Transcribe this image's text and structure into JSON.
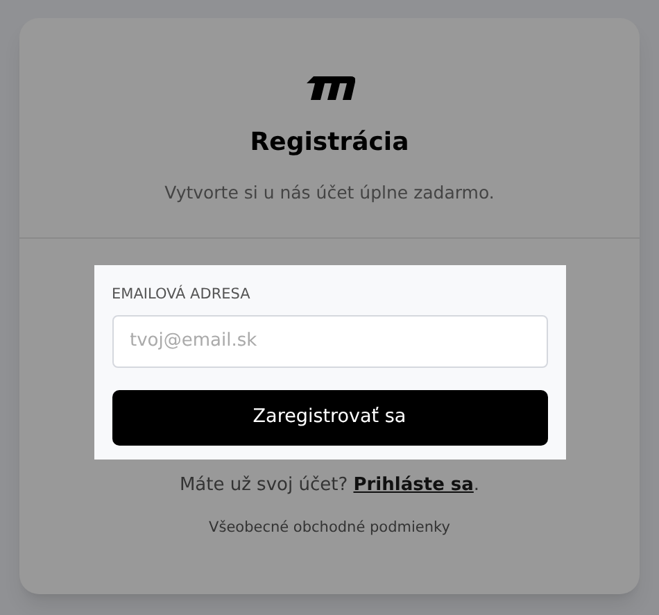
{
  "header": {
    "title": "Registrácia",
    "subtitle": "Vytvorte si u nás účet úplne zadarmo."
  },
  "form": {
    "highlighted": true,
    "email_label": "EMAILOVÁ ADRESA",
    "email_placeholder": "tvoj@email.sk",
    "submit": "Zaregistrovať sa"
  },
  "login_prompt": {
    "text": "Máte už svoj účet?",
    "link": "Prihláste sa",
    "suffix": "."
  },
  "terms_link": "Všeobecné obchodné podmienky"
}
